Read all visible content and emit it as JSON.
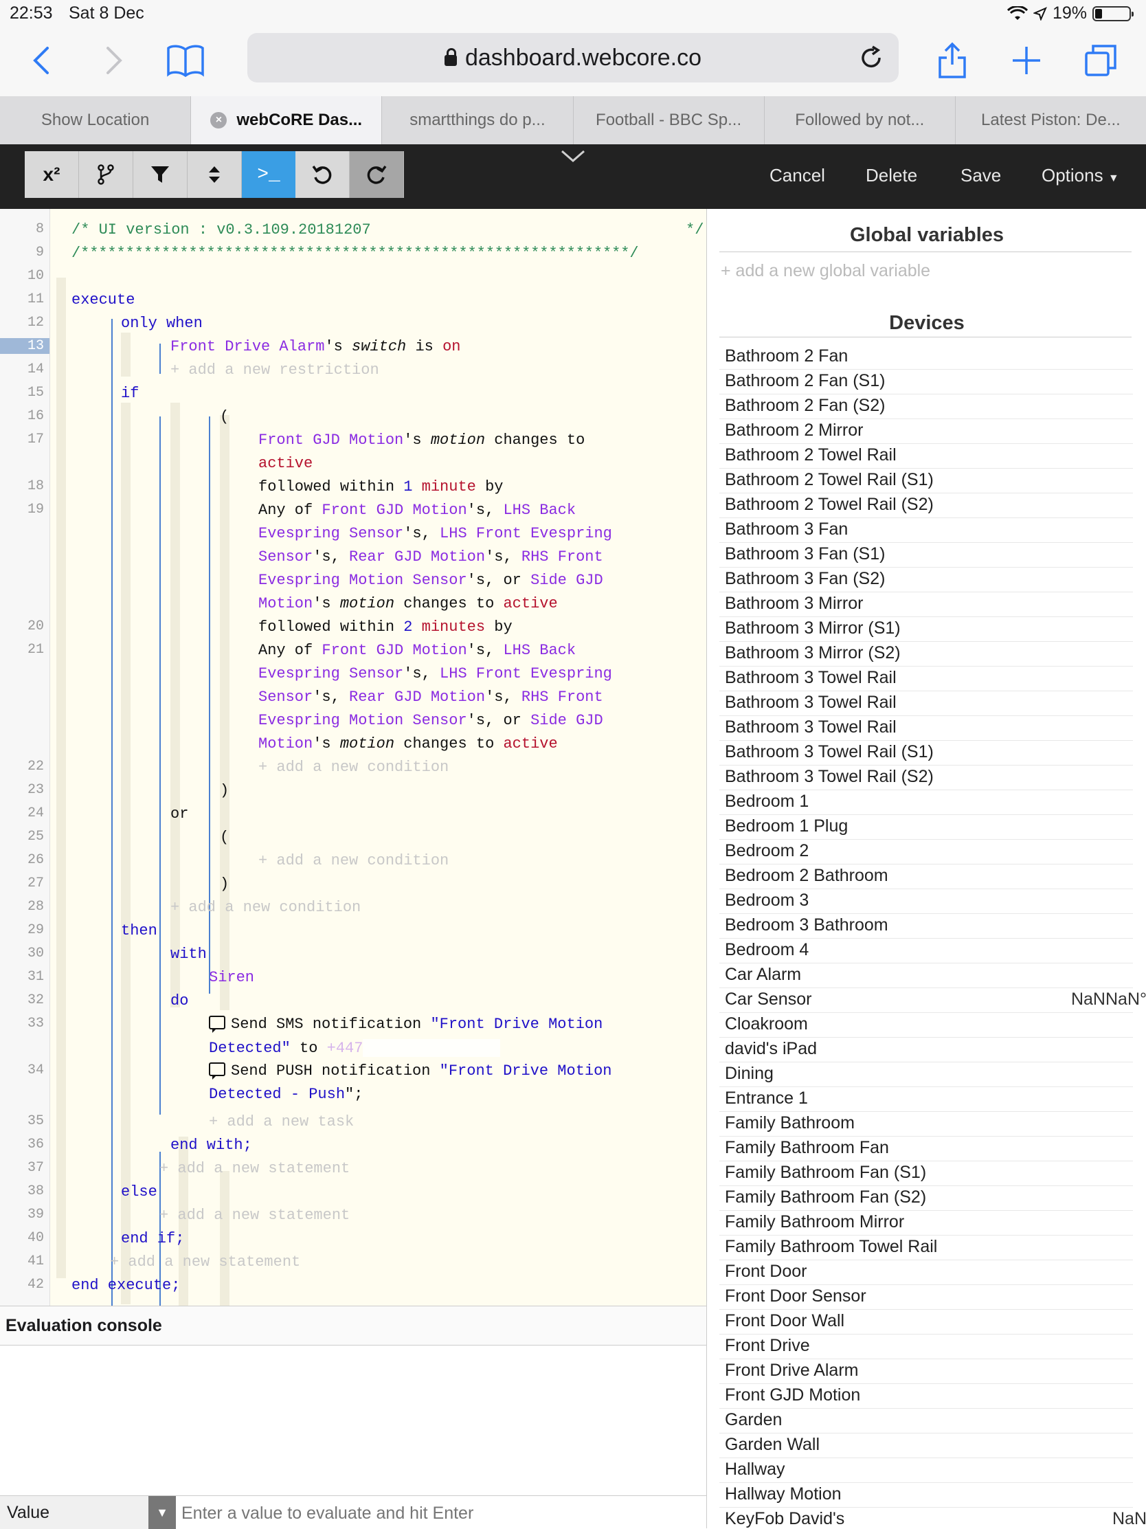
{
  "status_bar": {
    "time": "22:53",
    "date": "Sat 8 Dec",
    "battery": "19%"
  },
  "browser": {
    "url": "dashboard.webcore.co",
    "tabs": [
      {
        "label": "Show Location",
        "active": false
      },
      {
        "label": "webCoRE Das...",
        "active": true
      },
      {
        "label": "smartthings do p...",
        "active": false
      },
      {
        "label": "Football - BBC Sp...",
        "active": false
      },
      {
        "label": "Followed by not...",
        "active": false
      },
      {
        "label": "Latest Piston: De...",
        "active": false
      }
    ]
  },
  "editor_toolbar": {
    "buttons": [
      "x²",
      "fork",
      "filter",
      "sort",
      ">_",
      "undo",
      "redo"
    ],
    "cancel": "Cancel",
    "delete": "Delete",
    "save": "Save",
    "options": "Options"
  },
  "code": {
    "line_numbers": [
      "8",
      "9",
      "10",
      "11",
      "12",
      "13",
      "14",
      "15",
      "16",
      "17",
      "18",
      "19",
      "20",
      "21",
      "22",
      "23",
      "24",
      "25",
      "26",
      "27",
      "28",
      "29",
      "30",
      "31",
      "32",
      "33",
      "34",
      "35",
      "36",
      "37",
      "38",
      "39",
      "40",
      "41",
      "42"
    ],
    "ui_version": "/* UI version : v0.3.109.20181207",
    "comment_end": "*/",
    "stars": "/*************************************************************/",
    "execute": "execute",
    "only_when": "only when",
    "restriction_device": "Front Drive Alarm",
    "apostrophe_s": "'s",
    "switch": "switch",
    "is": "is",
    "on": "on",
    "add_restriction": "+ add a new restriction",
    "if": "if",
    "open_paren": "(",
    "close_paren": ")",
    "front_gjd": "Front GJD Motion",
    "motion": "motion",
    "changes_to": "changes to",
    "active": "active",
    "followed_within": "followed within",
    "one": "1",
    "minute": "minute",
    "by": "by",
    "two": "2",
    "minutes": "minutes",
    "any_of": "Any of",
    "lhs_back": "LHS Back",
    "evespring_sensor": "Evespring Sensor",
    "lhs_front_evespring": "LHS Front Evespring",
    "sensor": "Sensor",
    "rear_gjd": "Rear GJD Motion",
    "rhs_front": "RHS Front",
    "evespring_motion_sensor": "Evespring Motion Sensor",
    "or": "or",
    "side_gjd": "Side GJD",
    "motion_dev": "Motion",
    "add_condition": "+ add a new condition",
    "then": "then",
    "with": "with",
    "siren": "Siren",
    "do": "do",
    "send_sms": "Send SMS notification",
    "msg1": "\"Front Drive Motion",
    "msg1b": "Detected\"",
    "to": "to",
    "phone": "+447",
    "send_push": "Send PUSH notification",
    "msg2": "\"Front Drive Motion",
    "msg2b": "Detected - Push",
    "msg2end": "\";",
    "add_task": "+ add a new task",
    "end_with": "end with;",
    "add_statement": "+ add a new statement",
    "else": "else",
    "end_if": "end if;",
    "end_execute": "end execute;",
    "comma": ",",
    "comma_or": ", or"
  },
  "evaluation_console": {
    "title": "Evaluation console",
    "select_value": "Value",
    "input_placeholder": "Enter a value to evaluate and hit Enter"
  },
  "right_panel": {
    "global_vars_title": "Global variables",
    "add_global": "+ add a new global variable",
    "devices_title": "Devices",
    "devices": [
      {
        "name": "Bathroom 2 Fan",
        "value": ""
      },
      {
        "name": "Bathroom 2 Fan (S1)",
        "value": ""
      },
      {
        "name": "Bathroom 2 Fan (S2)",
        "value": ""
      },
      {
        "name": "Bathroom 2 Mirror",
        "value": ""
      },
      {
        "name": "Bathroom 2 Towel Rail",
        "value": ""
      },
      {
        "name": "Bathroom 2 Towel Rail (S1)",
        "value": ""
      },
      {
        "name": "Bathroom 2 Towel Rail (S2)",
        "value": ""
      },
      {
        "name": "Bathroom 3 Fan",
        "value": ""
      },
      {
        "name": "Bathroom 3 Fan (S1)",
        "value": ""
      },
      {
        "name": "Bathroom 3 Fan (S2)",
        "value": ""
      },
      {
        "name": "Bathroom 3 Mirror",
        "value": ""
      },
      {
        "name": "Bathroom 3 Mirror (S1)",
        "value": ""
      },
      {
        "name": "Bathroom 3 Mirror (S2)",
        "value": ""
      },
      {
        "name": "Bathroom 3 Towel Rail",
        "value": ""
      },
      {
        "name": "Bathroom 3 Towel Rail",
        "value": ""
      },
      {
        "name": "Bathroom 3 Towel Rail",
        "value": ""
      },
      {
        "name": "Bathroom 3 Towel Rail (S1)",
        "value": ""
      },
      {
        "name": "Bathroom 3 Towel Rail (S2)",
        "value": ""
      },
      {
        "name": "Bedroom 1",
        "value": ""
      },
      {
        "name": "Bedroom 1 Plug",
        "value": ""
      },
      {
        "name": "Bedroom 2",
        "value": ""
      },
      {
        "name": "Bedroom 2 Bathroom",
        "value": ""
      },
      {
        "name": "Bedroom 3",
        "value": ""
      },
      {
        "name": "Bedroom 3 Bathroom",
        "value": ""
      },
      {
        "name": "Bedroom 4",
        "value": ""
      },
      {
        "name": "Car Alarm",
        "value": ""
      },
      {
        "name": "Car Sensor",
        "value": "NaNNaN°"
      },
      {
        "name": "Cloakroom",
        "value": ""
      },
      {
        "name": "david's iPad",
        "value": ""
      },
      {
        "name": "Dining",
        "value": ""
      },
      {
        "name": "Entrance 1",
        "value": ""
      },
      {
        "name": "Family Bathroom",
        "value": ""
      },
      {
        "name": "Family Bathroom Fan",
        "value": ""
      },
      {
        "name": "Family Bathroom Fan (S1)",
        "value": ""
      },
      {
        "name": "Family Bathroom Fan (S2)",
        "value": ""
      },
      {
        "name": "Family Bathroom Mirror",
        "value": ""
      },
      {
        "name": "Family Bathroom Towel Rail",
        "value": ""
      },
      {
        "name": "Front Door",
        "value": ""
      },
      {
        "name": "Front Door Sensor",
        "value": ""
      },
      {
        "name": "Front Door Wall",
        "value": ""
      },
      {
        "name": "Front Drive",
        "value": ""
      },
      {
        "name": "Front Drive Alarm",
        "value": ""
      },
      {
        "name": "Front GJD Motion",
        "value": ""
      },
      {
        "name": "Garden",
        "value": ""
      },
      {
        "name": "Garden Wall",
        "value": ""
      },
      {
        "name": "Hallway",
        "value": ""
      },
      {
        "name": "Hallway Motion",
        "value": ""
      },
      {
        "name": "KeyFob David's",
        "value": "NaN"
      }
    ]
  },
  "colors": {
    "accent": "#2f7bf5",
    "active_tool": "#3a9ee4",
    "keyword": "#1f10c8",
    "device": "#8a2be2",
    "value": "#b5122e",
    "comment": "#2e8b57"
  }
}
